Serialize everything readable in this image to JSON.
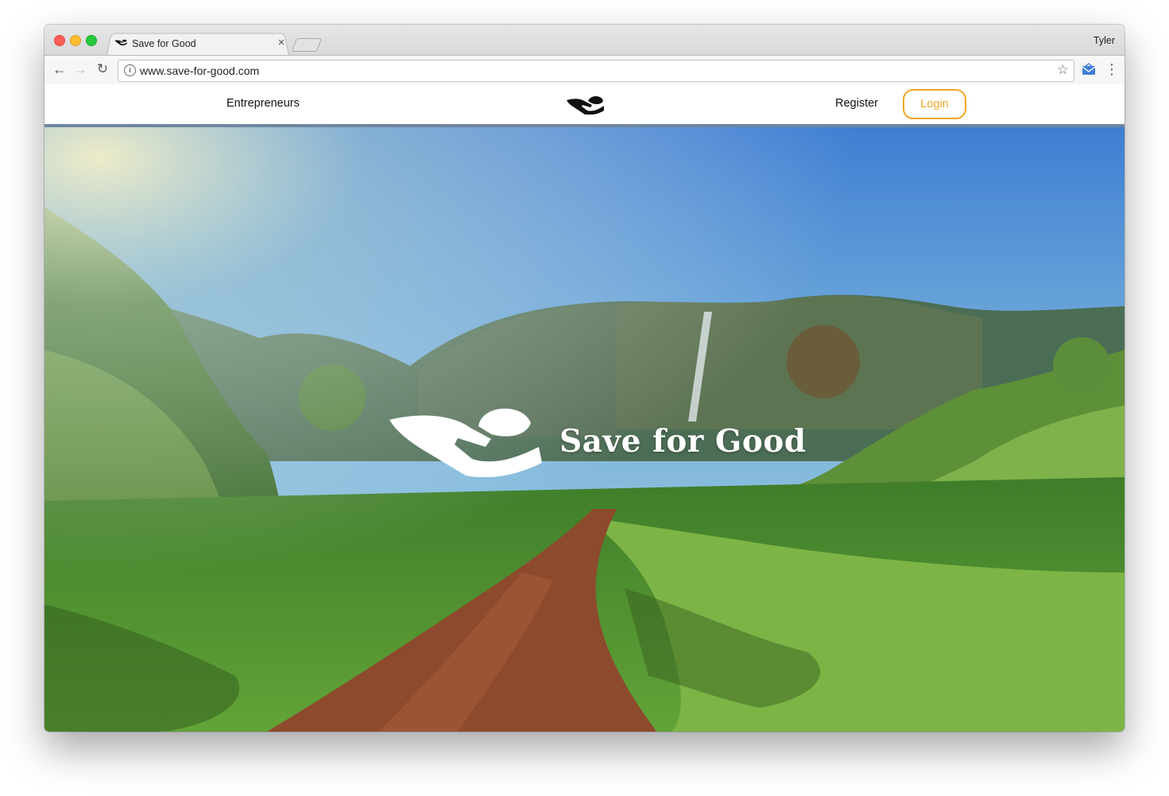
{
  "browser": {
    "tab_title": "Save for Good",
    "tab_close": "×",
    "profile_name": "Tyler",
    "url": "www.save-for-good.com",
    "icons": {
      "back": "arrow-left",
      "forward": "arrow-right",
      "reload": "reload",
      "info": "info",
      "bookmark": "star",
      "extension": "envelope",
      "menu": "more-vertical"
    }
  },
  "site": {
    "nav": {
      "entrepreneurs": "Entrepreneurs",
      "register": "Register",
      "login": "Login"
    },
    "hero": {
      "title": "Save for Good"
    },
    "colors": {
      "accent": "#f5a623",
      "header_border": "#6f86a0"
    }
  }
}
